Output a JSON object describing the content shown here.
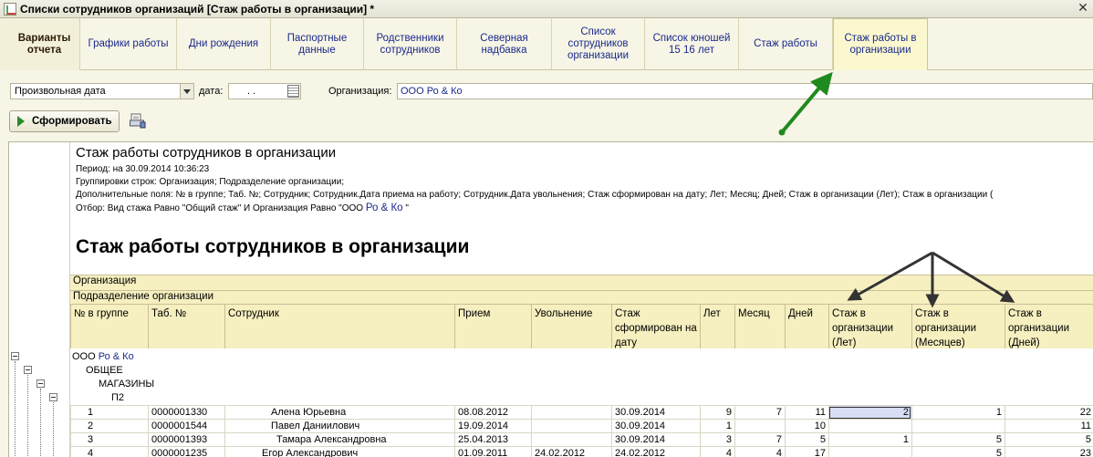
{
  "window": {
    "title": "Списки сотрудников организаций [Стаж работы в организации] *"
  },
  "tabs": [
    {
      "label": "Варианты отчета"
    },
    {
      "label": "Графики работы"
    },
    {
      "label": "Дни рождения"
    },
    {
      "label": "Паспортные данные"
    },
    {
      "label": "Родственники сотрудников"
    },
    {
      "label": "Северная надбавка"
    },
    {
      "label": "Список сотрудников организации"
    },
    {
      "label": "Список юношей 15 16 лет"
    },
    {
      "label": "Стаж работы"
    },
    {
      "label": "Стаж работы в организации"
    }
  ],
  "filters": {
    "period_type": "Произвольная дата",
    "date_label": "дата:",
    "date_value": ". .",
    "org_label": "Организация:",
    "org_value": "ООО Ро & Ко"
  },
  "toolbar": {
    "generate_label": "Сформировать"
  },
  "report": {
    "title": "Стаж работы сотрудников в организации",
    "period": "Период: на 30.09.2014 10:36:23",
    "grouping": "Группировки строк: Организация; Подразделение организации;",
    "extra_fields": "Дополнительные поля: № в группе; Таб. №; Сотрудник; Сотрудник.Дата приема на работу; Сотрудник.Дата увольнения; Стаж сформирован на дату; Лет; Месяц; Дней; Стаж в организации (Лет); Стаж в организации (",
    "filter_prefix": "Отбор: Вид стажа Равно \"Общий стаж\" И Организация Равно \"ООО ",
    "filter_org": "Ро & Ко",
    "filter_suffix": " \"",
    "big_title": "Стаж работы сотрудников в организации",
    "band_org": "Организация",
    "band_dept": "Подразделение организации",
    "columns": [
      "№ в группе",
      "Таб. №",
      "Сотрудник",
      "Прием",
      "Увольнение",
      "Стаж сформирован на дату",
      "Лет",
      "Месяц",
      "Дней",
      "Стаж в организации (Лет)",
      "Стаж в организации (Месяцев)",
      "Стаж в организации (Дней)"
    ],
    "groups": {
      "org_prefix": "ООО",
      "org_name": "Ро & Ко",
      "dept1": "ОБЩЕЕ",
      "dept2": "МАГАЗИНЫ",
      "dept3": "П2"
    },
    "rows": [
      {
        "n": "1",
        "tab": "0000001330",
        "emp": "Алена Юрьевна",
        "hire": "08.08.2012",
        "fire": "",
        "asof": "30.09.2014",
        "y": "9",
        "m": "7",
        "d": "11",
        "oy": "2",
        "om": "1",
        "od": "22"
      },
      {
        "n": "2",
        "tab": "0000001544",
        "emp": "Павел Даниилович",
        "hire": "19.09.2014",
        "fire": "",
        "asof": "30.09.2014",
        "y": "1",
        "m": "",
        "d": "10",
        "oy": "",
        "om": "",
        "od": "11"
      },
      {
        "n": "3",
        "tab": "0000001393",
        "emp": "Тамара Александровна",
        "hire": "25.04.2013",
        "fire": "",
        "asof": "30.09.2014",
        "y": "3",
        "m": "7",
        "d": "5",
        "oy": "1",
        "om": "5",
        "od": "5"
      },
      {
        "n": "4",
        "tab": "0000001235",
        "emp": "Егор Александрович",
        "hire": "01.09.2011",
        "fire": "24.02.2012",
        "asof": "24.02.2012",
        "y": "4",
        "m": "4",
        "d": "17",
        "oy": "",
        "om": "5",
        "od": "23"
      }
    ]
  },
  "colors": {
    "arrow_green": "#1f8a1f",
    "arrow_dark": "#333333",
    "header_band": "#f6efbf",
    "link_blue": "#1a2a8a"
  }
}
